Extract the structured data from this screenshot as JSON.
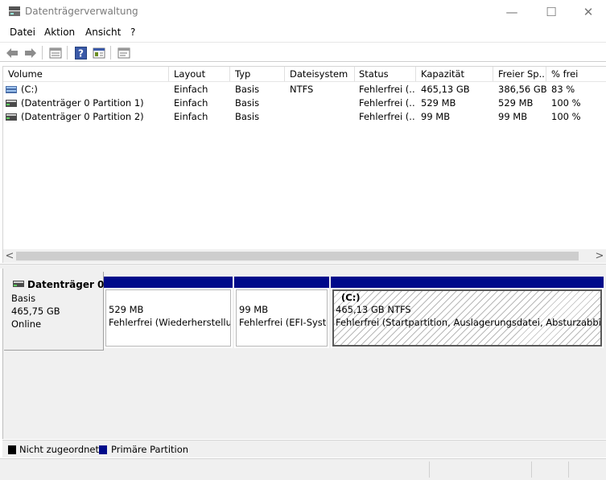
{
  "window": {
    "title": "Datenträgerverwaltung",
    "controls": {
      "minimize": "—",
      "maximize": "☐",
      "close": "✕"
    }
  },
  "menu": {
    "items": [
      "Datei",
      "Aktion",
      "Ansicht",
      "?"
    ]
  },
  "toolbar": {
    "buttons": [
      "back-arrow-icon",
      "forward-arrow-icon",
      "list-view-icon",
      "help-icon",
      "properties-icon",
      "console-icon"
    ]
  },
  "volume_list": {
    "columns": [
      "Volume",
      "Layout",
      "Typ",
      "Dateisystem",
      "Status",
      "Kapazität",
      "Freier Sp...",
      "% frei"
    ],
    "rows": [
      {
        "icon": "volume-drive-icon",
        "volume": "(C:)",
        "layout": "Einfach",
        "typ": "Basis",
        "dateisystem": "NTFS",
        "status": "Fehlerfrei (...",
        "kapazitaet": "465,13 GB",
        "frei": "386,56 GB",
        "prozent": "83 %"
      },
      {
        "icon": "partition-icon",
        "volume": "(Datenträger 0 Partition 1)",
        "layout": "Einfach",
        "typ": "Basis",
        "dateisystem": "",
        "status": "Fehlerfrei (...",
        "kapazitaet": "529 MB",
        "frei": "529 MB",
        "prozent": "100 %"
      },
      {
        "icon": "partition-icon",
        "volume": "(Datenträger 0 Partition 2)",
        "layout": "Einfach",
        "typ": "Basis",
        "dateisystem": "",
        "status": "Fehlerfrei (...",
        "kapazitaet": "99 MB",
        "frei": "99 MB",
        "prozent": "100 %"
      }
    ],
    "scroll_left": "<",
    "scroll_right": ">"
  },
  "disk": {
    "name": "Datenträger 0",
    "type": "Basis",
    "size": "465,75 GB",
    "state": "Online",
    "partitions": [
      {
        "label": "",
        "size": "529 MB",
        "status": "Fehlerfrei (Wiederherstellun",
        "selected": false
      },
      {
        "label": "",
        "size": "99 MB",
        "status": "Fehlerfrei (EFI-Syste",
        "selected": false
      },
      {
        "label": "(C:)",
        "size": "465,13 GB NTFS",
        "status": "Fehlerfrei (Startpartition, Auslagerungsdatei, Absturzabbild, Ba",
        "selected": true
      }
    ]
  },
  "legend": {
    "unallocated": {
      "label": "Nicht zugeordnet",
      "color": "#000000"
    },
    "primary": {
      "label": "Primäre Partition",
      "color": "#000a8a"
    }
  }
}
